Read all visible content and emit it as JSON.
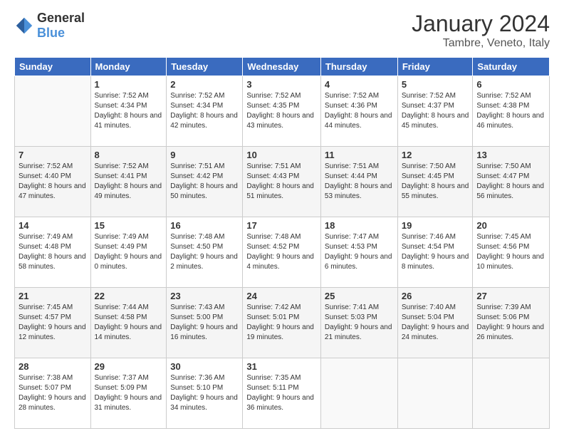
{
  "logo": {
    "general": "General",
    "blue": "Blue"
  },
  "header": {
    "month": "January 2024",
    "location": "Tambre, Veneto, Italy"
  },
  "weekdays": [
    "Sunday",
    "Monday",
    "Tuesday",
    "Wednesday",
    "Thursday",
    "Friday",
    "Saturday"
  ],
  "weeks": [
    [
      {
        "day": "",
        "sunrise": "",
        "sunset": "",
        "daylight": ""
      },
      {
        "day": "1",
        "sunrise": "Sunrise: 7:52 AM",
        "sunset": "Sunset: 4:34 PM",
        "daylight": "Daylight: 8 hours and 41 minutes."
      },
      {
        "day": "2",
        "sunrise": "Sunrise: 7:52 AM",
        "sunset": "Sunset: 4:34 PM",
        "daylight": "Daylight: 8 hours and 42 minutes."
      },
      {
        "day": "3",
        "sunrise": "Sunrise: 7:52 AM",
        "sunset": "Sunset: 4:35 PM",
        "daylight": "Daylight: 8 hours and 43 minutes."
      },
      {
        "day": "4",
        "sunrise": "Sunrise: 7:52 AM",
        "sunset": "Sunset: 4:36 PM",
        "daylight": "Daylight: 8 hours and 44 minutes."
      },
      {
        "day": "5",
        "sunrise": "Sunrise: 7:52 AM",
        "sunset": "Sunset: 4:37 PM",
        "daylight": "Daylight: 8 hours and 45 minutes."
      },
      {
        "day": "6",
        "sunrise": "Sunrise: 7:52 AM",
        "sunset": "Sunset: 4:38 PM",
        "daylight": "Daylight: 8 hours and 46 minutes."
      }
    ],
    [
      {
        "day": "7",
        "sunrise": "Sunrise: 7:52 AM",
        "sunset": "Sunset: 4:40 PM",
        "daylight": "Daylight: 8 hours and 47 minutes."
      },
      {
        "day": "8",
        "sunrise": "Sunrise: 7:52 AM",
        "sunset": "Sunset: 4:41 PM",
        "daylight": "Daylight: 8 hours and 49 minutes."
      },
      {
        "day": "9",
        "sunrise": "Sunrise: 7:51 AM",
        "sunset": "Sunset: 4:42 PM",
        "daylight": "Daylight: 8 hours and 50 minutes."
      },
      {
        "day": "10",
        "sunrise": "Sunrise: 7:51 AM",
        "sunset": "Sunset: 4:43 PM",
        "daylight": "Daylight: 8 hours and 51 minutes."
      },
      {
        "day": "11",
        "sunrise": "Sunrise: 7:51 AM",
        "sunset": "Sunset: 4:44 PM",
        "daylight": "Daylight: 8 hours and 53 minutes."
      },
      {
        "day": "12",
        "sunrise": "Sunrise: 7:50 AM",
        "sunset": "Sunset: 4:45 PM",
        "daylight": "Daylight: 8 hours and 55 minutes."
      },
      {
        "day": "13",
        "sunrise": "Sunrise: 7:50 AM",
        "sunset": "Sunset: 4:47 PM",
        "daylight": "Daylight: 8 hours and 56 minutes."
      }
    ],
    [
      {
        "day": "14",
        "sunrise": "Sunrise: 7:49 AM",
        "sunset": "Sunset: 4:48 PM",
        "daylight": "Daylight: 8 hours and 58 minutes."
      },
      {
        "day": "15",
        "sunrise": "Sunrise: 7:49 AM",
        "sunset": "Sunset: 4:49 PM",
        "daylight": "Daylight: 9 hours and 0 minutes."
      },
      {
        "day": "16",
        "sunrise": "Sunrise: 7:48 AM",
        "sunset": "Sunset: 4:50 PM",
        "daylight": "Daylight: 9 hours and 2 minutes."
      },
      {
        "day": "17",
        "sunrise": "Sunrise: 7:48 AM",
        "sunset": "Sunset: 4:52 PM",
        "daylight": "Daylight: 9 hours and 4 minutes."
      },
      {
        "day": "18",
        "sunrise": "Sunrise: 7:47 AM",
        "sunset": "Sunset: 4:53 PM",
        "daylight": "Daylight: 9 hours and 6 minutes."
      },
      {
        "day": "19",
        "sunrise": "Sunrise: 7:46 AM",
        "sunset": "Sunset: 4:54 PM",
        "daylight": "Daylight: 9 hours and 8 minutes."
      },
      {
        "day": "20",
        "sunrise": "Sunrise: 7:45 AM",
        "sunset": "Sunset: 4:56 PM",
        "daylight": "Daylight: 9 hours and 10 minutes."
      }
    ],
    [
      {
        "day": "21",
        "sunrise": "Sunrise: 7:45 AM",
        "sunset": "Sunset: 4:57 PM",
        "daylight": "Daylight: 9 hours and 12 minutes."
      },
      {
        "day": "22",
        "sunrise": "Sunrise: 7:44 AM",
        "sunset": "Sunset: 4:58 PM",
        "daylight": "Daylight: 9 hours and 14 minutes."
      },
      {
        "day": "23",
        "sunrise": "Sunrise: 7:43 AM",
        "sunset": "Sunset: 5:00 PM",
        "daylight": "Daylight: 9 hours and 16 minutes."
      },
      {
        "day": "24",
        "sunrise": "Sunrise: 7:42 AM",
        "sunset": "Sunset: 5:01 PM",
        "daylight": "Daylight: 9 hours and 19 minutes."
      },
      {
        "day": "25",
        "sunrise": "Sunrise: 7:41 AM",
        "sunset": "Sunset: 5:03 PM",
        "daylight": "Daylight: 9 hours and 21 minutes."
      },
      {
        "day": "26",
        "sunrise": "Sunrise: 7:40 AM",
        "sunset": "Sunset: 5:04 PM",
        "daylight": "Daylight: 9 hours and 24 minutes."
      },
      {
        "day": "27",
        "sunrise": "Sunrise: 7:39 AM",
        "sunset": "Sunset: 5:06 PM",
        "daylight": "Daylight: 9 hours and 26 minutes."
      }
    ],
    [
      {
        "day": "28",
        "sunrise": "Sunrise: 7:38 AM",
        "sunset": "Sunset: 5:07 PM",
        "daylight": "Daylight: 9 hours and 28 minutes."
      },
      {
        "day": "29",
        "sunrise": "Sunrise: 7:37 AM",
        "sunset": "Sunset: 5:09 PM",
        "daylight": "Daylight: 9 hours and 31 minutes."
      },
      {
        "day": "30",
        "sunrise": "Sunrise: 7:36 AM",
        "sunset": "Sunset: 5:10 PM",
        "daylight": "Daylight: 9 hours and 34 minutes."
      },
      {
        "day": "31",
        "sunrise": "Sunrise: 7:35 AM",
        "sunset": "Sunset: 5:11 PM",
        "daylight": "Daylight: 9 hours and 36 minutes."
      },
      {
        "day": "",
        "sunrise": "",
        "sunset": "",
        "daylight": ""
      },
      {
        "day": "",
        "sunrise": "",
        "sunset": "",
        "daylight": ""
      },
      {
        "day": "",
        "sunrise": "",
        "sunset": "",
        "daylight": ""
      }
    ]
  ]
}
